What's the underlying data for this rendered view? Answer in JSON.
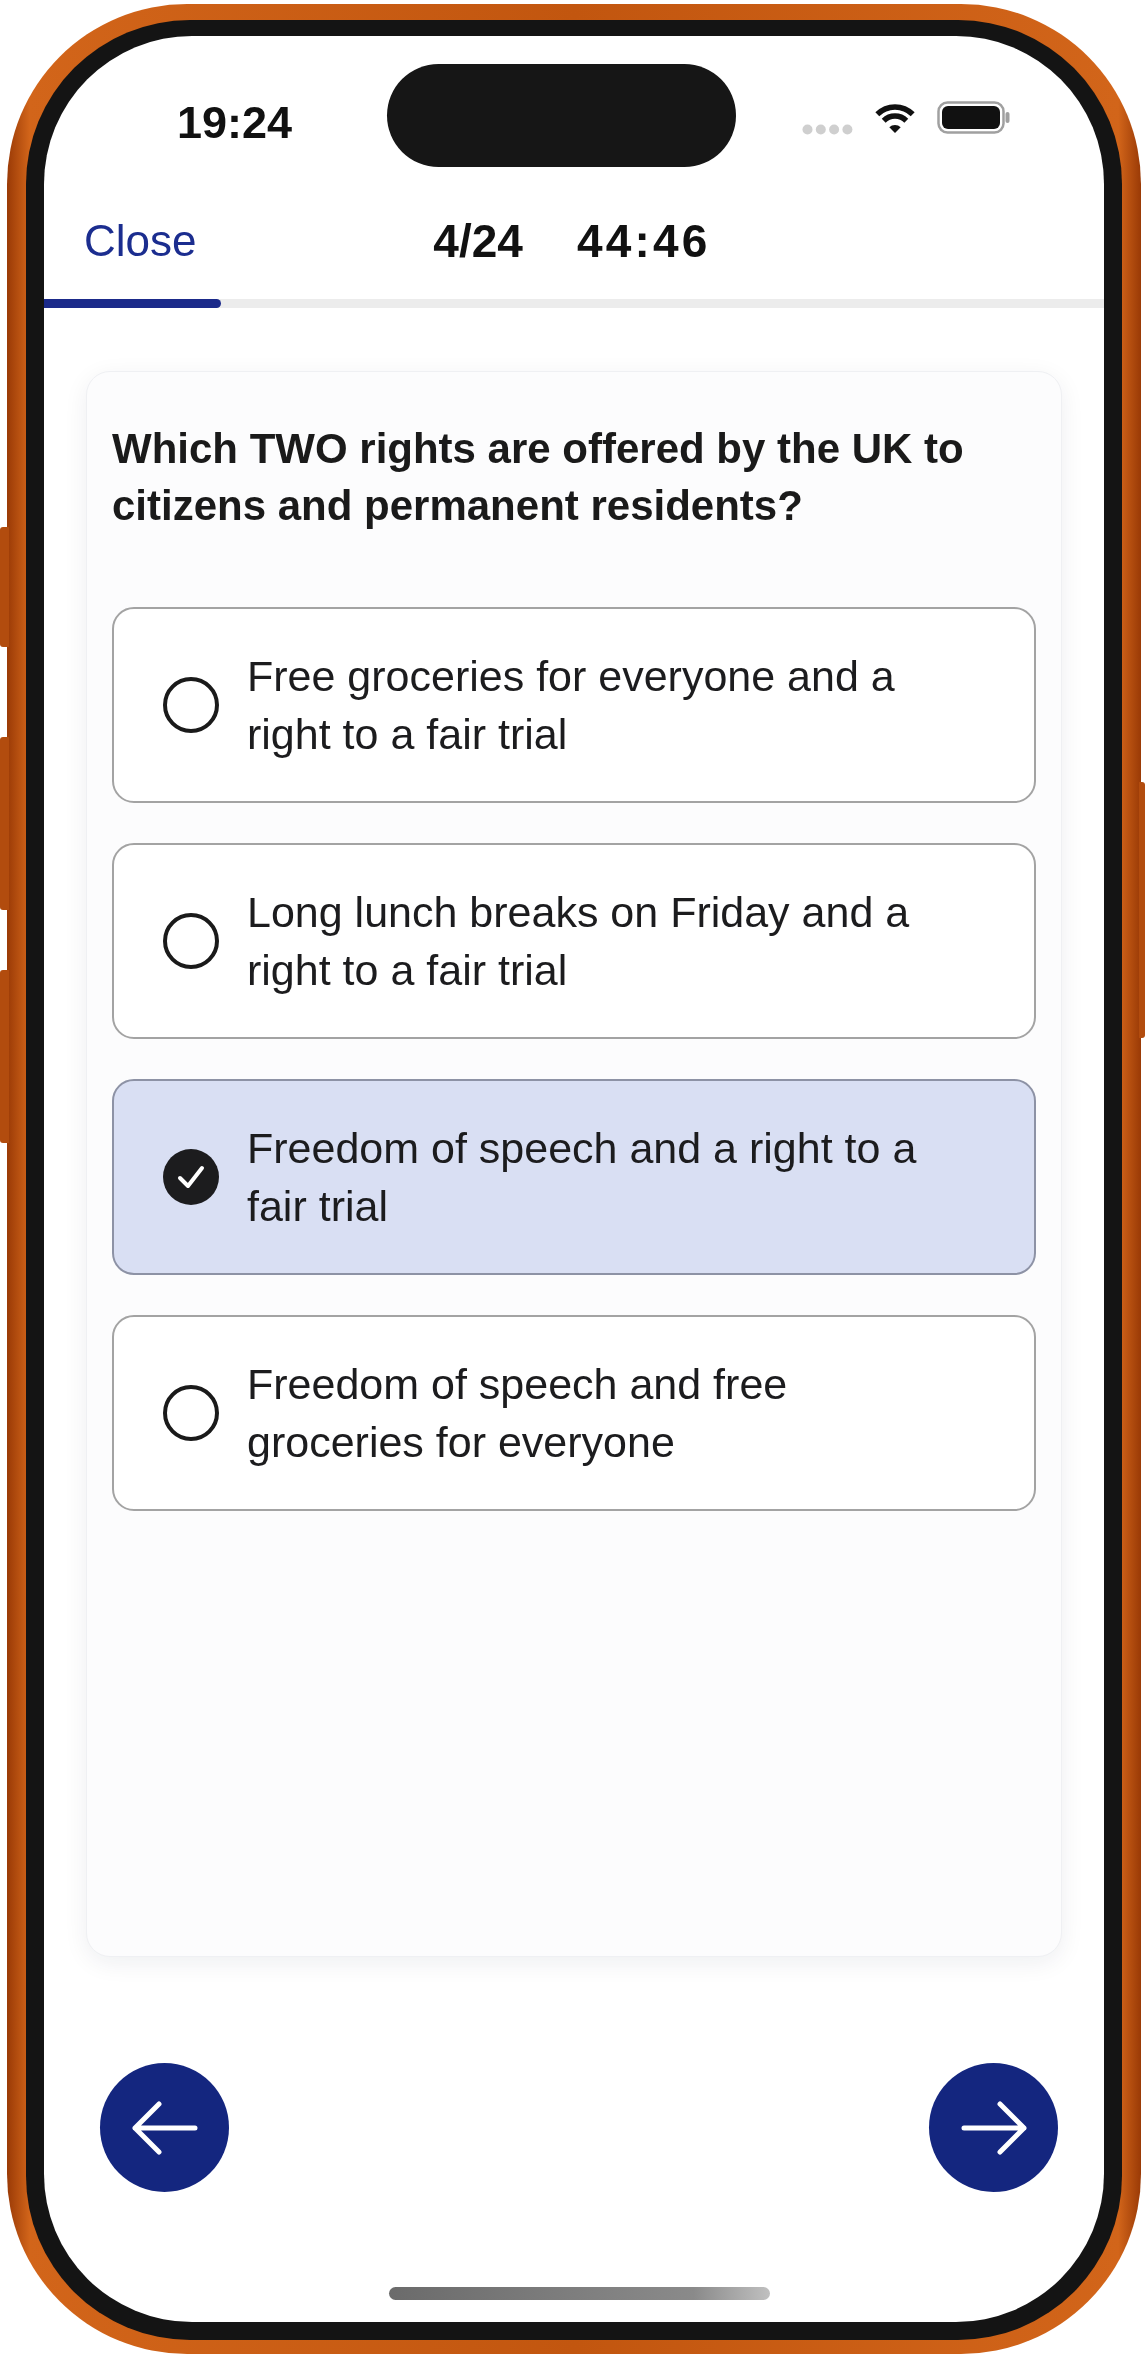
{
  "status_bar": {
    "time": "19:24"
  },
  "header": {
    "close": "Close",
    "counter": "4/24",
    "timer": "44:46",
    "progress": {
      "level": 0.167
    }
  },
  "question": {
    "text": "Which TWO rights are offered by the UK to citizens and permanent residents?",
    "options": [
      {
        "text": "Free groceries for everyone and a right to a fair trial",
        "selected": false
      },
      {
        "text": "Long lunch breaks on Friday and a right to a fair trial",
        "selected": false
      },
      {
        "text": "Freedom of speech and a right to a fair trial",
        "selected": true
      },
      {
        "text": "Freedom of speech and free groceries for everyone",
        "selected": false
      }
    ]
  }
}
